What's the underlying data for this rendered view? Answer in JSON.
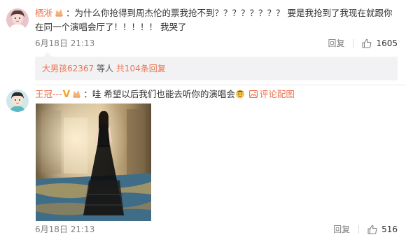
{
  "comments": [
    {
      "username": "栖淅",
      "text": "：为什么你抢得到周杰伦的票我抢不到？？？？？？？？ 要是我抢到了我现在就跟你在同一个演唱会厅了！！！！！ 我哭了",
      "time": "6月18日 21:13",
      "reply_label": "回复",
      "like_count": "1605",
      "sub_replies": {
        "user": "大男孩62367",
        "middle": " 等人 ",
        "total": "共104条回复"
      }
    },
    {
      "username": "王冠---",
      "text": "：哇 希望以后我们也能去听你的演唱会",
      "view_pic": "评论配图",
      "time": "6月18日 21:13",
      "reply_label": "回复",
      "like_count": "516"
    }
  ],
  "colors": {
    "link": "#eb7350",
    "meta": "#808080",
    "sub_bg": "#f2f2f5"
  }
}
